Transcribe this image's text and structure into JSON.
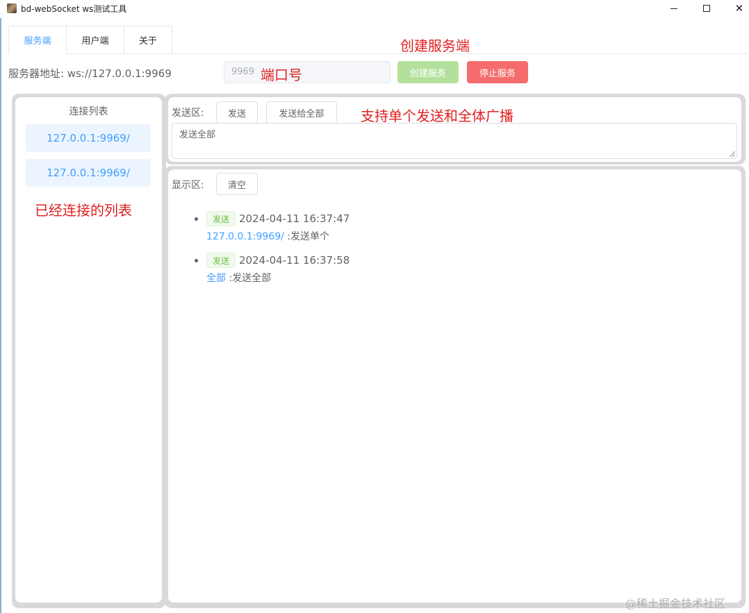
{
  "window": {
    "title": "bd-webSocket ws测试工具",
    "controls": {
      "minimize": "—",
      "maximize": "☐",
      "close": "✕"
    }
  },
  "tabs": [
    {
      "label": "服务端",
      "active": true
    },
    {
      "label": "用户端",
      "active": false
    },
    {
      "label": "关于",
      "active": false
    }
  ],
  "annotations": {
    "create_server": "创建服务端",
    "port": "端口号",
    "broadcast": "支持单个发送和全体广播",
    "connected_list": "已经连接的列表"
  },
  "server": {
    "address_label": "服务器地址:  ws://127.0.0.1:9969",
    "port_value": "9969",
    "create_button": "创建服务",
    "stop_button": "停止服务"
  },
  "connections": {
    "title": "连接列表",
    "items": [
      "127.0.0.1:9969/",
      "127.0.0.1:9969/"
    ]
  },
  "send_area": {
    "label": "发送区:",
    "send_button": "发送",
    "send_all_button": "发送给全部",
    "textarea_value": "发送全部"
  },
  "display_area": {
    "label": "显示区:",
    "clear_button": "清空",
    "messages": [
      {
        "tag": "发送",
        "time": "2024-04-11 16:37:47",
        "target": "127.0.0.1:9969/",
        "text": " :发送单个"
      },
      {
        "tag": "发送",
        "time": "2024-04-11 16:37:58",
        "target": "全部",
        "text": " :发送全部"
      }
    ]
  },
  "watermark": "@稀土掘金技术社区",
  "colors": {
    "primary": "#409eff",
    "success_light": "#b3e19d",
    "danger": "#f56c6c",
    "annotation": "#e02020",
    "tag_green": "#67c23a"
  }
}
